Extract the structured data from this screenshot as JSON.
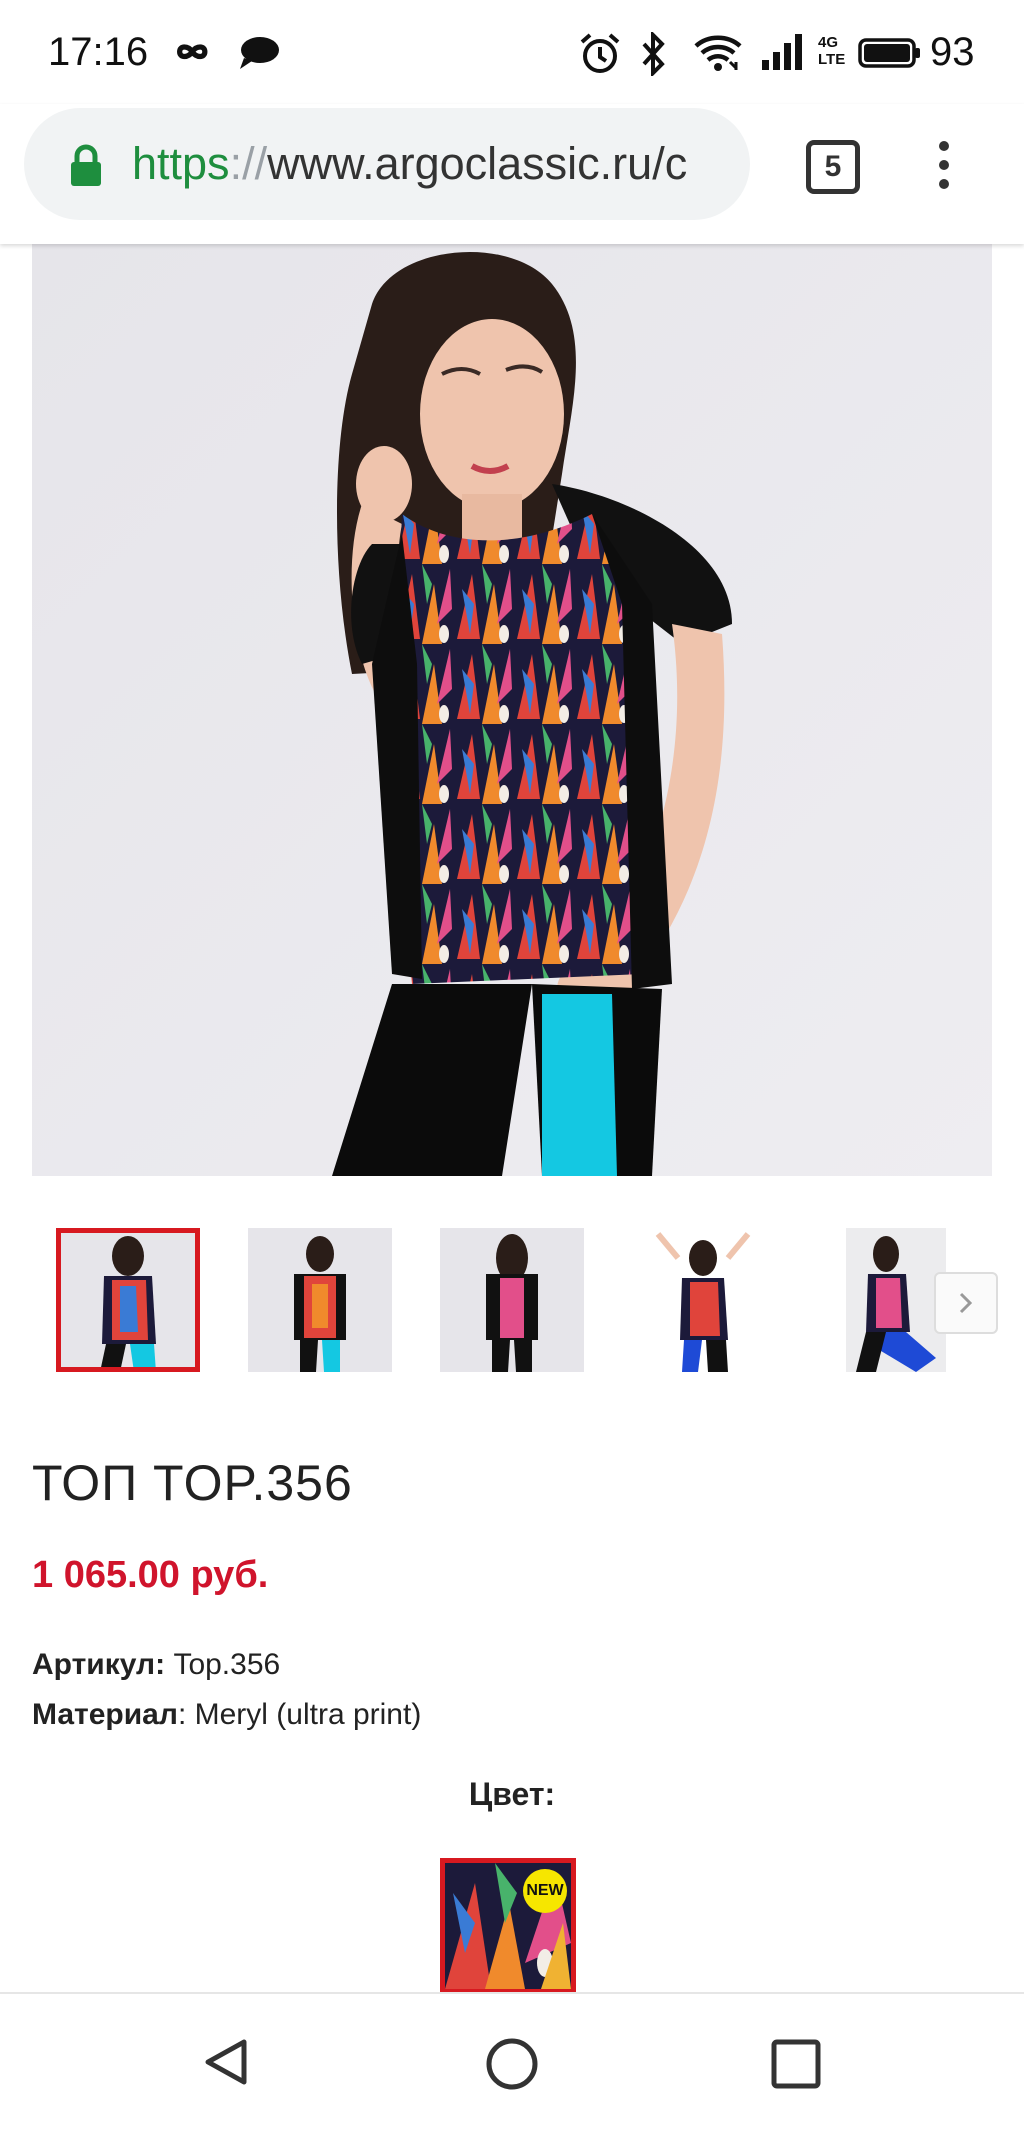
{
  "status_bar": {
    "time": "17:16",
    "network_top": "4G",
    "network_bottom": "LTE",
    "battery": "93",
    "icons": [
      "infinity-icon",
      "chat-bubble-icon",
      "alarm-icon",
      "bluetooth-icon",
      "wifi-icon",
      "signal-icon",
      "battery-icon"
    ]
  },
  "browser": {
    "url_scheme": "https",
    "url_sep": "://",
    "url_host": "www.argoclassic.ru/c",
    "tab_count": "5"
  },
  "gallery": {
    "thumbnail_count": 5,
    "active_index": 0,
    "accent": "#d71920"
  },
  "product": {
    "title": "ТОП TOP.356",
    "price": "1 065.00 руб.",
    "sku_label": "Артикул:",
    "sku_value": "Top.356",
    "material_label": "Материал",
    "material_value": ": Meryl (ultra print)",
    "color_heading": "Цвет:",
    "swatch_badge": "NEW"
  },
  "colors": {
    "price": "#d0142c",
    "accent": "#d71920",
    "url_green": "#1e8e3e",
    "badge": "#f6e600"
  }
}
